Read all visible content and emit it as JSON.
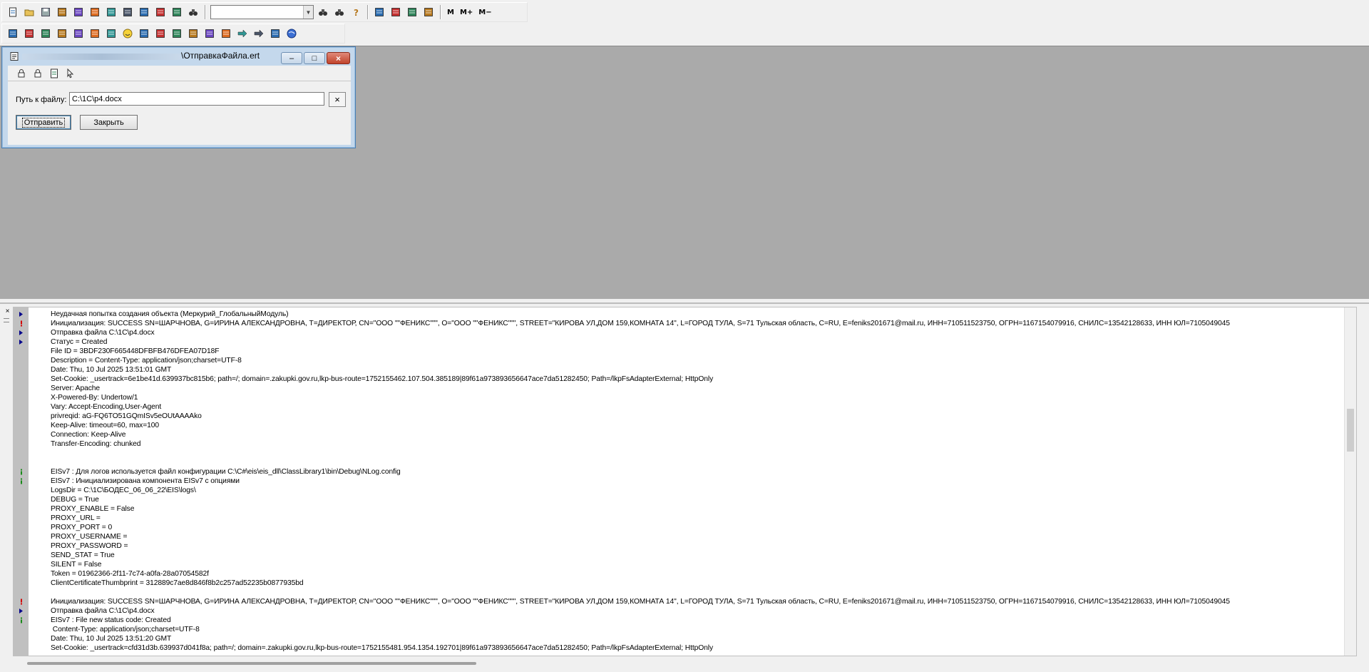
{
  "toolbar": {
    "row1_icons": [
      "new-doc-icon",
      "open-folder-icon",
      "save-icon",
      "cut-icon",
      "copy-icon",
      "paste-icon",
      "print-icon",
      "print-preview-icon",
      "config-icon",
      "undo-icon",
      "redo-icon",
      "binoculars-icon"
    ],
    "row1_icons_b": [
      "find-replace-icon",
      "find-next-icon",
      "help-icon"
    ],
    "row1_icons_c": [
      "table-icon",
      "calc-icon",
      "chat-icon",
      "book-icon"
    ],
    "m_buttons": [
      "M",
      "M+",
      "M−"
    ],
    "row2_icons": [
      "run-icon",
      "debug-icon",
      "mark-icon",
      "unmark-icon",
      "cube-icon",
      "grid-icon",
      "form-icon",
      "smile-icon",
      "palette-icon",
      "colors-icon",
      "coin-icon",
      "text-icon",
      "layout-icon",
      "list-icon",
      "arrow-right-icon",
      "arrow-red-icon",
      "users-icon",
      "globe-icon"
    ]
  },
  "child_window": {
    "caption": "\\ОтправкаФайла.ert",
    "sub_toolbar_icons": [
      "lock-unlock-icon",
      "lock-icon",
      "help-doc-icon",
      "pointer-icon"
    ],
    "field_label": "Путь к файлу:",
    "path_value": "C:\\1C\\p4.docx",
    "clear_symbol": "×",
    "send_label": "Отправить",
    "close_label": "Закрыть",
    "win_min": "–",
    "win_max": "□",
    "win_close": "×"
  },
  "messages": {
    "close_symbol": "×",
    "lines": [
      {
        "mark": "arrow",
        "text": "Неудачная попытка создания объекта (Меркурий_ГлобальныйМодуль)"
      },
      {
        "mark": "excl",
        "text": "Инициализация: SUCCESS SN=ШАРЧНОВА, G=ИРИНА АЛЕКСАНДРОВНА, T=ДИРЕКТОР, CN=\"ООО \"\"ФЕНИКС\"\"\", O=\"ООО \"\"ФЕНИКС\"\"\", STREET=\"КИРОВА УЛ,ДОМ 159,КОМНАТА 14\", L=ГОРОД ТУЛА, S=71 Тульская область, C=RU, E=feniks201671@mail.ru, ИНН=710511523750, ОГРН=1167154079916, СНИЛС=13542128633, ИНН ЮЛ=7105049045"
      },
      {
        "mark": "arrow",
        "text": "Отправка файла C:\\1C\\p4.docx"
      },
      {
        "mark": "arrow",
        "text": "Статус = Created"
      },
      {
        "mark": "",
        "text": "File ID = 3BDF230F665448DFBFB476DFEA07D18F"
      },
      {
        "mark": "",
        "text": "Description = Content-Type: application/json;charset=UTF-8"
      },
      {
        "mark": "",
        "text": "Date: Thu, 10 Jul 2025 13:51:01 GMT"
      },
      {
        "mark": "",
        "text": "Set-Cookie: _usertrack=6e1be41d.639937bc815b6; path=/; domain=.zakupki.gov.ru,lkp-bus-route=1752155462.107.504.385189|89f61a973893656647ace7da51282450; Path=/lkpFsAdapterExternal; HttpOnly"
      },
      {
        "mark": "",
        "text": "Server: Apache"
      },
      {
        "mark": "",
        "text": "X-Powered-By: Undertow/1"
      },
      {
        "mark": "",
        "text": "Vary: Accept-Encoding,User-Agent"
      },
      {
        "mark": "",
        "text": "privreqid: aG-FQ6TO51GQmISv5eOUtAAAAko"
      },
      {
        "mark": "",
        "text": "Keep-Alive: timeout=60, max=100"
      },
      {
        "mark": "",
        "text": "Connection: Keep-Alive"
      },
      {
        "mark": "",
        "text": "Transfer-Encoding: chunked"
      },
      {
        "mark": "",
        "text": ""
      },
      {
        "mark": "",
        "text": ""
      },
      {
        "mark": "info",
        "text": "EISv7 : Для логов используется файл конфигурации C:\\C#\\eis\\eis_dll\\ClassLibrary1\\bin\\Debug\\NLog.config"
      },
      {
        "mark": "info",
        "text": "EISv7 : Инициализирована компонента EISv7 с опциями"
      },
      {
        "mark": "",
        "text": "LogsDir = C:\\1C\\БОДЕС_06_06_22\\EIS\\logs\\"
      },
      {
        "mark": "",
        "text": "DEBUG = True"
      },
      {
        "mark": "",
        "text": "PROXY_ENABLE = False"
      },
      {
        "mark": "",
        "text": "PROXY_URL ="
      },
      {
        "mark": "",
        "text": "PROXY_PORT = 0"
      },
      {
        "mark": "",
        "text": "PROXY_USERNAME ="
      },
      {
        "mark": "",
        "text": "PROXY_PASSWORD ="
      },
      {
        "mark": "",
        "text": "SEND_STAT = True"
      },
      {
        "mark": "",
        "text": "SILENT = False"
      },
      {
        "mark": "",
        "text": "Token = 01962366-2f11-7c74-a0fa-28a07054582f"
      },
      {
        "mark": "",
        "text": "ClientCertificateThumbprint = 312889c7ae8d846f8b2c257ad52235b0877935bd"
      },
      {
        "mark": "",
        "text": ""
      },
      {
        "mark": "excl",
        "text": "Инициализация: SUCCESS SN=ШАРЧНОВА, G=ИРИНА АЛЕКСАНДРОВНА, T=ДИРЕКТОР, CN=\"ООО \"\"ФЕНИКС\"\"\", O=\"ООО \"\"ФЕНИКС\"\"\", STREET=\"КИРОВА УЛ,ДОМ 159,КОМНАТА 14\", L=ГОРОД ТУЛА, S=71 Тульская область, C=RU, E=feniks201671@mail.ru, ИНН=710511523750, ОГРН=1167154079916, СНИЛС=13542128633, ИНН ЮЛ=7105049045"
      },
      {
        "mark": "arrow",
        "text": "Отправка файла C:\\1C\\p4.docx"
      },
      {
        "mark": "info",
        "text": "EISv7 : File new status code: Created"
      },
      {
        "mark": "",
        "text": " Content-Type: application/json;charset=UTF-8"
      },
      {
        "mark": "",
        "text": "Date: Thu, 10 Jul 2025 13:51:20 GMT"
      },
      {
        "mark": "",
        "text": "Set-Cookie: _usertrack=cfd31d3b.639937d041f8a; path=/; domain=.zakupki.gov.ru,lkp-bus-route=1752155481.954.1354.192701|89f61a973893656647ace7da51282450; Path=/lkpFsAdapterExternal; HttpOnly"
      }
    ]
  },
  "colors": {
    "mdi_background": "#aaaaaa",
    "arrow_mark": "#00008b",
    "excl_mark": "#d40000",
    "info_mark": "#1a8a1a"
  }
}
